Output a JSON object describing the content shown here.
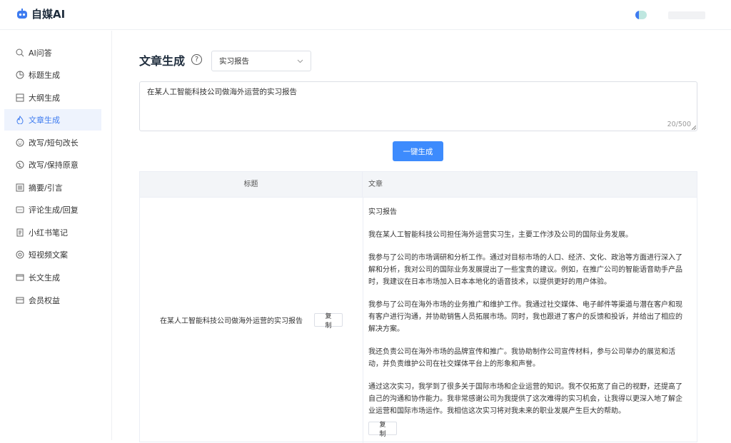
{
  "app": {
    "logo_text": "自媒AI"
  },
  "sidebar": {
    "items": [
      {
        "label": "AI问答",
        "icon": "search-icon"
      },
      {
        "label": "标题生成",
        "icon": "clock-icon"
      },
      {
        "label": "大纲生成",
        "icon": "outline-icon"
      },
      {
        "label": "文章生成",
        "icon": "flame-icon",
        "active": true
      },
      {
        "label": "改写/短句改长",
        "icon": "smile-icon"
      },
      {
        "label": "改写/保持原意",
        "icon": "globe-icon"
      },
      {
        "label": "摘要/引言",
        "icon": "list-icon"
      },
      {
        "label": "评论生成/回复",
        "icon": "comment-icon"
      },
      {
        "label": "小红书笔记",
        "icon": "note-icon"
      },
      {
        "label": "短视频文案",
        "icon": "video-icon"
      },
      {
        "label": "长文生成",
        "icon": "window-icon"
      },
      {
        "label": "会员权益",
        "icon": "card-icon"
      }
    ]
  },
  "main": {
    "title": "文章生成",
    "help": "?",
    "select_value": "实习报告",
    "input_value": "在某人工智能科技公司做海外运营的实习报告",
    "counter": "20/500",
    "generate_label": "一键生成",
    "table": {
      "headers": {
        "title": "标题",
        "article": "文章"
      },
      "row": {
        "title": "在某人工智能科技公司做海外运营的实习报告",
        "copy_label": "复制",
        "article": [
          "实习报告",
          "我在某人工智能科技公司担任海外运营实习生，主要工作涉及公司的国际业务发展。",
          "我参与了公司的市场调研和分析工作。通过对目标市场的人口、经济、文化、政治等方面进行深入了解和分析，我对公司的国际业务发展提出了一些宝贵的建议。例如，在推广公司的智能语音助手产品时，我建议在日本市场加入日本本地化的语音技术，以提供更好的用户体验。",
          "我参与了公司在海外市场的业务推广和维护工作。我通过社交媒体、电子邮件等渠道与潜在客户和现有客户进行沟通，并协助销售人员拓展市场。同时，我也跟进了客户的反馈和投诉，并给出了相应的解决方案。",
          "我还负责公司在海外市场的品牌宣传和推广。我协助制作公司宣传材料，参与公司举办的展览和活动，并负责维护公司在社交媒体平台上的形象和声誉。",
          "通过这次实习，我学到了很多关于国际市场和企业运营的知识。我不仅拓宽了自己的视野，还提高了自己的沟通和协作能力。我非常感谢公司为我提供了这次难得的实习机会，让我得以更深入地了解企业运营和国际市场运作。我相信这次实习将对我未来的职业发展产生巨大的帮助。"
        ],
        "copy_bottom_label": "复制"
      }
    }
  },
  "colors": {
    "accent": "#3d7bf0",
    "button": "#3d8bfd",
    "active_bg": "#eef3fd"
  }
}
